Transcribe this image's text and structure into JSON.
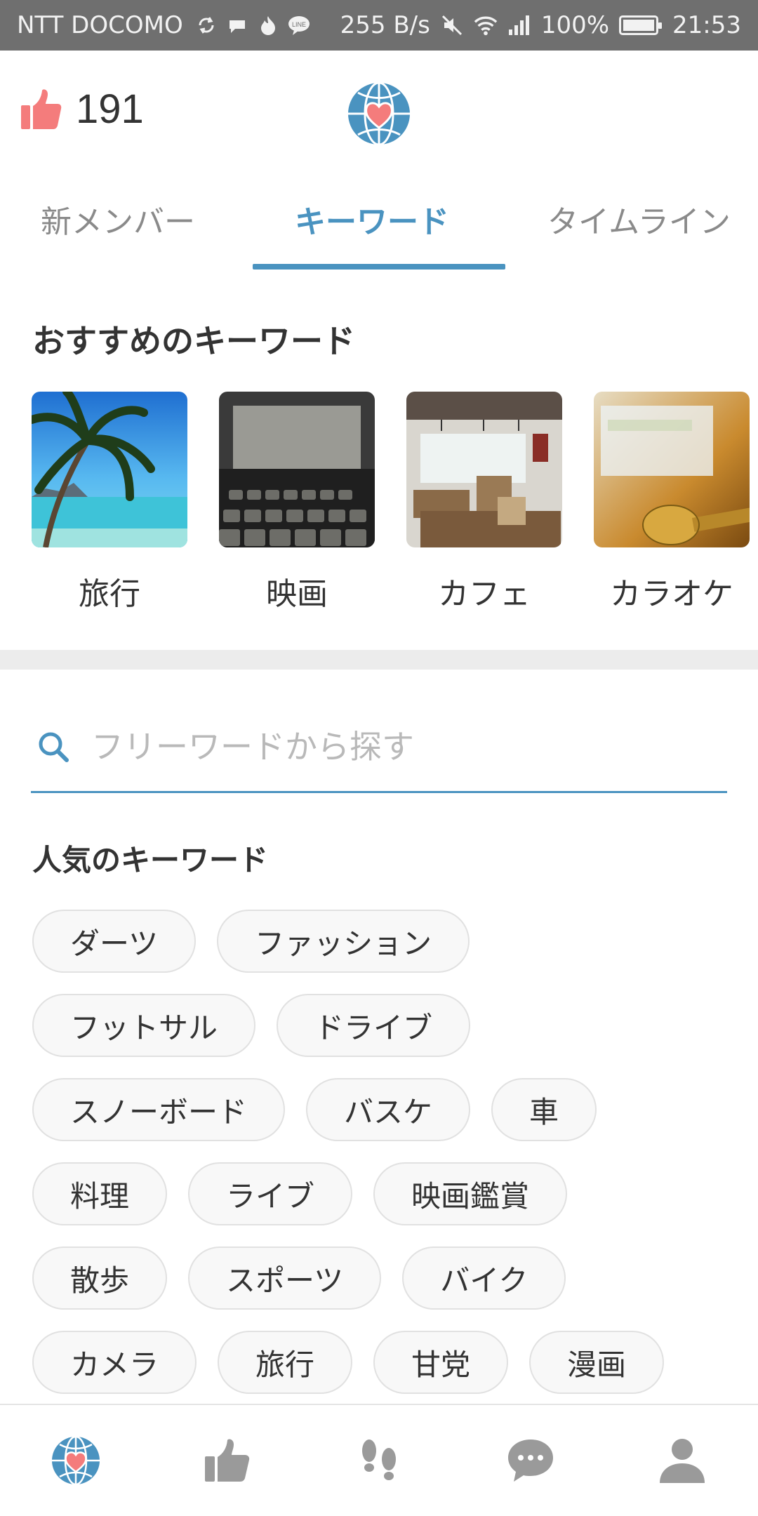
{
  "status_bar": {
    "carrier": "NTT DOCOMO",
    "net_speed": "255 B/s",
    "battery": "100%",
    "battery_level": 1.0,
    "time": "21:53",
    "icons": [
      "sync-icon",
      "app-icon",
      "flame-icon",
      "line-icon",
      "mute-icon",
      "wifi-icon",
      "signal-icon",
      "battery-icon"
    ]
  },
  "header": {
    "like_count": "191",
    "icons": [
      "thumbs-up-icon",
      "globe-heart-logo"
    ]
  },
  "tabs": [
    {
      "label": "新メンバー",
      "active": false
    },
    {
      "label": "キーワード",
      "active": true
    },
    {
      "label": "タイムライン",
      "active": false
    }
  ],
  "recommended": {
    "title": "おすすめのキーワード",
    "items": [
      {
        "label": "旅行",
        "image": "beach-palm"
      },
      {
        "label": "映画",
        "image": "cinema-seats"
      },
      {
        "label": "カフェ",
        "image": "cafe-interior"
      },
      {
        "label": "カラオケ",
        "image": "karaoke-mic"
      }
    ]
  },
  "search": {
    "placeholder": "フリーワードから探す"
  },
  "popular": {
    "title": "人気のキーワード",
    "rows": [
      [
        "ダーツ",
        "ファッション"
      ],
      [
        "フットサル",
        "ドライブ"
      ],
      [
        "スノーボード",
        "バスケ",
        "車"
      ],
      [
        "料理",
        "ライブ",
        "映画鑑賞"
      ],
      [
        "散歩",
        "スポーツ",
        "バイク"
      ],
      [
        "カメラ",
        "旅行",
        "甘党",
        "漫画"
      ]
    ]
  },
  "bottom_nav": [
    "globe-heart-icon",
    "thumbs-up-icon",
    "footprints-icon",
    "chat-bubble-icon",
    "person-icon"
  ],
  "colors": {
    "accent": "#4a93c0",
    "like": "#f47c7c",
    "nav_inactive": "#9a9a9a"
  }
}
